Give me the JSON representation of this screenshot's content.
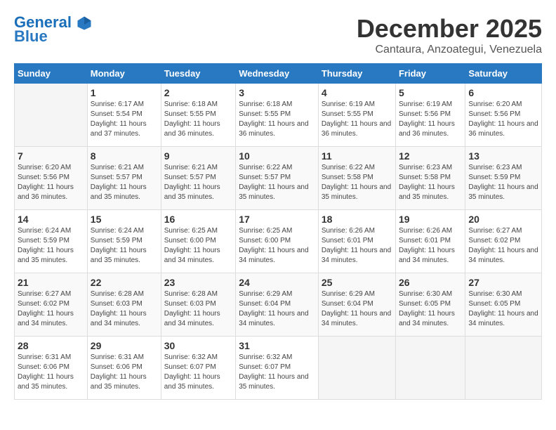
{
  "logo": {
    "line1": "General",
    "line2": "Blue"
  },
  "title": "December 2025",
  "location": "Cantaura, Anzoategui, Venezuela",
  "days_of_week": [
    "Sunday",
    "Monday",
    "Tuesday",
    "Wednesday",
    "Thursday",
    "Friday",
    "Saturday"
  ],
  "weeks": [
    [
      {
        "day": "",
        "sunrise": "",
        "sunset": "",
        "daylight": ""
      },
      {
        "day": "1",
        "sunrise": "Sunrise: 6:17 AM",
        "sunset": "Sunset: 5:54 PM",
        "daylight": "Daylight: 11 hours and 37 minutes."
      },
      {
        "day": "2",
        "sunrise": "Sunrise: 6:18 AM",
        "sunset": "Sunset: 5:55 PM",
        "daylight": "Daylight: 11 hours and 36 minutes."
      },
      {
        "day": "3",
        "sunrise": "Sunrise: 6:18 AM",
        "sunset": "Sunset: 5:55 PM",
        "daylight": "Daylight: 11 hours and 36 minutes."
      },
      {
        "day": "4",
        "sunrise": "Sunrise: 6:19 AM",
        "sunset": "Sunset: 5:55 PM",
        "daylight": "Daylight: 11 hours and 36 minutes."
      },
      {
        "day": "5",
        "sunrise": "Sunrise: 6:19 AM",
        "sunset": "Sunset: 5:56 PM",
        "daylight": "Daylight: 11 hours and 36 minutes."
      },
      {
        "day": "6",
        "sunrise": "Sunrise: 6:20 AM",
        "sunset": "Sunset: 5:56 PM",
        "daylight": "Daylight: 11 hours and 36 minutes."
      }
    ],
    [
      {
        "day": "7",
        "sunrise": "Sunrise: 6:20 AM",
        "sunset": "Sunset: 5:56 PM",
        "daylight": "Daylight: 11 hours and 36 minutes."
      },
      {
        "day": "8",
        "sunrise": "Sunrise: 6:21 AM",
        "sunset": "Sunset: 5:57 PM",
        "daylight": "Daylight: 11 hours and 35 minutes."
      },
      {
        "day": "9",
        "sunrise": "Sunrise: 6:21 AM",
        "sunset": "Sunset: 5:57 PM",
        "daylight": "Daylight: 11 hours and 35 minutes."
      },
      {
        "day": "10",
        "sunrise": "Sunrise: 6:22 AM",
        "sunset": "Sunset: 5:57 PM",
        "daylight": "Daylight: 11 hours and 35 minutes."
      },
      {
        "day": "11",
        "sunrise": "Sunrise: 6:22 AM",
        "sunset": "Sunset: 5:58 PM",
        "daylight": "Daylight: 11 hours and 35 minutes."
      },
      {
        "day": "12",
        "sunrise": "Sunrise: 6:23 AM",
        "sunset": "Sunset: 5:58 PM",
        "daylight": "Daylight: 11 hours and 35 minutes."
      },
      {
        "day": "13",
        "sunrise": "Sunrise: 6:23 AM",
        "sunset": "Sunset: 5:59 PM",
        "daylight": "Daylight: 11 hours and 35 minutes."
      }
    ],
    [
      {
        "day": "14",
        "sunrise": "Sunrise: 6:24 AM",
        "sunset": "Sunset: 5:59 PM",
        "daylight": "Daylight: 11 hours and 35 minutes."
      },
      {
        "day": "15",
        "sunrise": "Sunrise: 6:24 AM",
        "sunset": "Sunset: 5:59 PM",
        "daylight": "Daylight: 11 hours and 35 minutes."
      },
      {
        "day": "16",
        "sunrise": "Sunrise: 6:25 AM",
        "sunset": "Sunset: 6:00 PM",
        "daylight": "Daylight: 11 hours and 34 minutes."
      },
      {
        "day": "17",
        "sunrise": "Sunrise: 6:25 AM",
        "sunset": "Sunset: 6:00 PM",
        "daylight": "Daylight: 11 hours and 34 minutes."
      },
      {
        "day": "18",
        "sunrise": "Sunrise: 6:26 AM",
        "sunset": "Sunset: 6:01 PM",
        "daylight": "Daylight: 11 hours and 34 minutes."
      },
      {
        "day": "19",
        "sunrise": "Sunrise: 6:26 AM",
        "sunset": "Sunset: 6:01 PM",
        "daylight": "Daylight: 11 hours and 34 minutes."
      },
      {
        "day": "20",
        "sunrise": "Sunrise: 6:27 AM",
        "sunset": "Sunset: 6:02 PM",
        "daylight": "Daylight: 11 hours and 34 minutes."
      }
    ],
    [
      {
        "day": "21",
        "sunrise": "Sunrise: 6:27 AM",
        "sunset": "Sunset: 6:02 PM",
        "daylight": "Daylight: 11 hours and 34 minutes."
      },
      {
        "day": "22",
        "sunrise": "Sunrise: 6:28 AM",
        "sunset": "Sunset: 6:03 PM",
        "daylight": "Daylight: 11 hours and 34 minutes."
      },
      {
        "day": "23",
        "sunrise": "Sunrise: 6:28 AM",
        "sunset": "Sunset: 6:03 PM",
        "daylight": "Daylight: 11 hours and 34 minutes."
      },
      {
        "day": "24",
        "sunrise": "Sunrise: 6:29 AM",
        "sunset": "Sunset: 6:04 PM",
        "daylight": "Daylight: 11 hours and 34 minutes."
      },
      {
        "day": "25",
        "sunrise": "Sunrise: 6:29 AM",
        "sunset": "Sunset: 6:04 PM",
        "daylight": "Daylight: 11 hours and 34 minutes."
      },
      {
        "day": "26",
        "sunrise": "Sunrise: 6:30 AM",
        "sunset": "Sunset: 6:05 PM",
        "daylight": "Daylight: 11 hours and 34 minutes."
      },
      {
        "day": "27",
        "sunrise": "Sunrise: 6:30 AM",
        "sunset": "Sunset: 6:05 PM",
        "daylight": "Daylight: 11 hours and 34 minutes."
      }
    ],
    [
      {
        "day": "28",
        "sunrise": "Sunrise: 6:31 AM",
        "sunset": "Sunset: 6:06 PM",
        "daylight": "Daylight: 11 hours and 35 minutes."
      },
      {
        "day": "29",
        "sunrise": "Sunrise: 6:31 AM",
        "sunset": "Sunset: 6:06 PM",
        "daylight": "Daylight: 11 hours and 35 minutes."
      },
      {
        "day": "30",
        "sunrise": "Sunrise: 6:32 AM",
        "sunset": "Sunset: 6:07 PM",
        "daylight": "Daylight: 11 hours and 35 minutes."
      },
      {
        "day": "31",
        "sunrise": "Sunrise: 6:32 AM",
        "sunset": "Sunset: 6:07 PM",
        "daylight": "Daylight: 11 hours and 35 minutes."
      },
      {
        "day": "",
        "sunrise": "",
        "sunset": "",
        "daylight": ""
      },
      {
        "day": "",
        "sunrise": "",
        "sunset": "",
        "daylight": ""
      },
      {
        "day": "",
        "sunrise": "",
        "sunset": "",
        "daylight": ""
      }
    ]
  ]
}
